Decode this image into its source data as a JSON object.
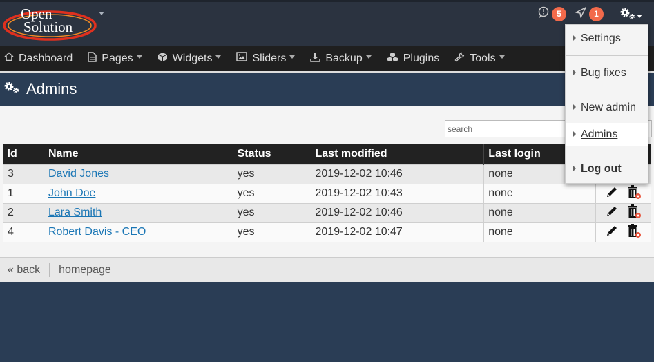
{
  "brand": {
    "line1": "Open",
    "line2": "Solution"
  },
  "notifications": {
    "messages_count": "5",
    "alerts_count": "1"
  },
  "nav": [
    {
      "label": "Dashboard",
      "icon": "home-icon"
    },
    {
      "label": "Pages",
      "icon": "page-icon"
    },
    {
      "label": "Widgets",
      "icon": "cube-icon"
    },
    {
      "label": "Sliders",
      "icon": "image-icon"
    },
    {
      "label": "Backup",
      "icon": "download-icon"
    },
    {
      "label": "Plugins",
      "icon": "cubes-icon"
    },
    {
      "label": "Tools",
      "icon": "wrench-icon"
    }
  ],
  "page": {
    "title": "Admins"
  },
  "search": {
    "placeholder": "search"
  },
  "table": {
    "columns": [
      "Id",
      "Name",
      "Status",
      "Last modified",
      "Last login"
    ],
    "rows": [
      {
        "id": "3",
        "name": "David Jones",
        "status": "yes",
        "modified": "2019-12-02 10:46",
        "login": "none"
      },
      {
        "id": "1",
        "name": "John Doe",
        "status": "yes",
        "modified": "2019-12-02 10:43",
        "login": "none"
      },
      {
        "id": "2",
        "name": "Lara Smith",
        "status": "yes",
        "modified": "2019-12-02 10:46",
        "login": "none"
      },
      {
        "id": "4",
        "name": "Robert Davis - CEO",
        "status": "yes",
        "modified": "2019-12-02 10:47",
        "login": "none"
      }
    ]
  },
  "footer": {
    "back": "« back",
    "home": "homepage"
  },
  "menu": {
    "settings": "Settings",
    "bug_fixes": "Bug fixes",
    "new_admin": "New admin",
    "admins": "Admins",
    "logout": "Log out"
  },
  "colors": {
    "accent_badge": "#f26a4b",
    "header_blue": "#2a3d55",
    "link": "#1a76b5"
  }
}
